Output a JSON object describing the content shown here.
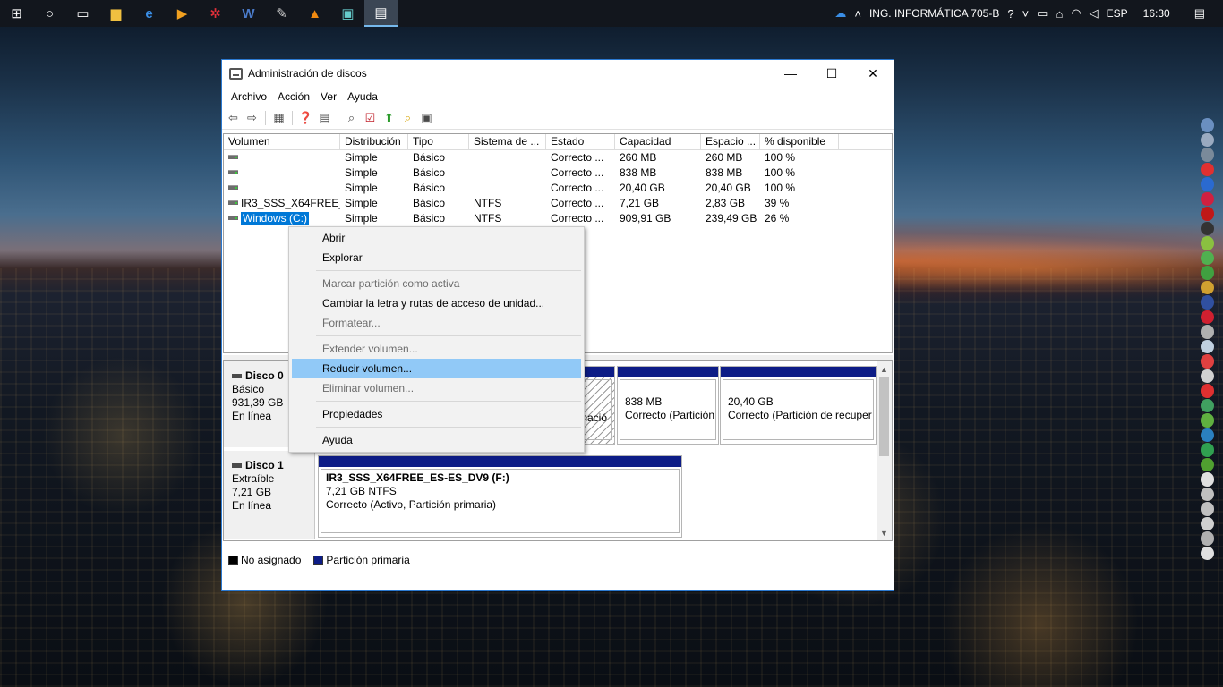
{
  "taskbar": {
    "apps": [
      {
        "icon": "windows-start-icon",
        "glyph": "⊞"
      },
      {
        "icon": "cortana-icon",
        "glyph": "○"
      },
      {
        "icon": "task-view-icon",
        "glyph": "▭"
      },
      {
        "icon": "file-explorer-icon",
        "glyph": "▆"
      },
      {
        "icon": "edge-icon",
        "glyph": "e"
      },
      {
        "icon": "media-player-icon",
        "glyph": "▶"
      },
      {
        "icon": "red-app-icon",
        "glyph": "✲"
      },
      {
        "icon": "word-icon",
        "glyph": "W"
      },
      {
        "icon": "pen-tool-icon",
        "glyph": "✎"
      },
      {
        "icon": "vlc-icon",
        "glyph": "▲"
      },
      {
        "icon": "remote-desktop-icon",
        "glyph": "▣"
      },
      {
        "icon": "disk-management-icon",
        "glyph": "▤"
      }
    ],
    "tray": {
      "network_name": "ING. INFORMÁTICA 705-B",
      "language": "ESP",
      "time": "16:30"
    }
  },
  "window": {
    "title": "Administración de discos",
    "menu": [
      "Archivo",
      "Acción",
      "Ver",
      "Ayuda"
    ],
    "volume_table": {
      "headers": [
        "Volumen",
        "Distribución",
        "Tipo",
        "Sistema de ...",
        "Estado",
        "Capacidad",
        "Espacio ...",
        "% disponible"
      ],
      "rows": [
        [
          "",
          "Simple",
          "Básico",
          "",
          "Correcto ...",
          "260 MB",
          "260 MB",
          "100 %"
        ],
        [
          "",
          "Simple",
          "Básico",
          "",
          "Correcto ...",
          "838 MB",
          "838 MB",
          "100 %"
        ],
        [
          "",
          "Simple",
          "Básico",
          "",
          "Correcto ...",
          "20,40 GB",
          "20,40 GB",
          "100 %"
        ],
        [
          "IR3_SSS_X64FREE_...",
          "Simple",
          "Básico",
          "NTFS",
          "Correcto ...",
          "7,21 GB",
          "2,83 GB",
          "39 %"
        ],
        [
          "Windows (C:)",
          "Simple",
          "Básico",
          "NTFS",
          "Correcto ...",
          "909,91 GB",
          "239,49 GB",
          "26 %"
        ]
      ]
    },
    "disks": [
      {
        "name": "Disco 0",
        "type": "Básico",
        "size": "931,39 GB",
        "status": "En línea",
        "partitions": [
          {
            "line1": "",
            "line2": "nació"
          },
          {
            "line1": "838 MB",
            "line2": "Correcto (Partición"
          },
          {
            "line1": "20,40 GB",
            "line2": "Correcto (Partición de recuper"
          }
        ]
      },
      {
        "name": "Disco 1",
        "type": "Extraíble",
        "size": "7,21 GB",
        "status": "En línea",
        "partitions": [
          {
            "title": "IR3_SSS_X64FREE_ES-ES_DV9  (F:)",
            "line1": "7,21 GB NTFS",
            "line2": "Correcto (Activo, Partición primaria)"
          }
        ]
      }
    ],
    "legend": [
      {
        "label": "No asignado",
        "color": "#000000"
      },
      {
        "label": "Partición primaria",
        "color": "#0d1c86"
      }
    ]
  },
  "context_menu": {
    "items": [
      "Abrir",
      "Explorar",
      "Marcar partición como activa",
      "Cambiar la letra y rutas de acceso de unidad...",
      "Formatear...",
      "Extender volumen...",
      "Reducir volumen...",
      "Eliminar volumen...",
      "Propiedades",
      "Ayuda"
    ]
  },
  "colors": {
    "accent": "#0078d7",
    "partition_bar": "#0d1c86",
    "menu_highlight": "#91c9f7"
  }
}
